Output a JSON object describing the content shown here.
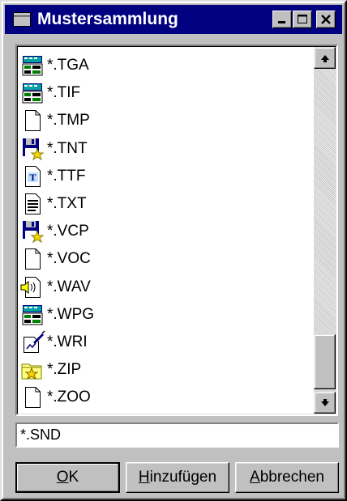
{
  "window": {
    "title": "Mustersammlung",
    "controls": [
      "minimize",
      "maximize",
      "close"
    ]
  },
  "list": {
    "items": [
      {
        "label": "*.TGA",
        "icon": "image-icon"
      },
      {
        "label": "*.TIF",
        "icon": "image-icon"
      },
      {
        "label": "*.TMP",
        "icon": "blank-document-icon"
      },
      {
        "label": "*.TNT",
        "icon": "floppy-disk-icon"
      },
      {
        "label": "*.TTF",
        "icon": "truetype-font-icon"
      },
      {
        "label": "*.TXT",
        "icon": "text-document-icon"
      },
      {
        "label": "*.VCP",
        "icon": "floppy-disk-icon"
      },
      {
        "label": "*.VOC",
        "icon": "blank-document-icon"
      },
      {
        "label": "*.WAV",
        "icon": "sound-icon"
      },
      {
        "label": "*.WPG",
        "icon": "image-icon"
      },
      {
        "label": "*.WRI",
        "icon": "write-document-icon"
      },
      {
        "label": "*.ZIP",
        "icon": "archive-folder-icon"
      },
      {
        "label": "*.ZOO",
        "icon": "blank-document-icon"
      }
    ]
  },
  "input": {
    "value": "*.SND"
  },
  "buttons": {
    "ok": {
      "mnemonic": "O",
      "rest": "K"
    },
    "add": {
      "mnemonic": "H",
      "rest": "inzufügen"
    },
    "cancel": {
      "mnemonic": "A",
      "rest": "bbrechen"
    }
  }
}
